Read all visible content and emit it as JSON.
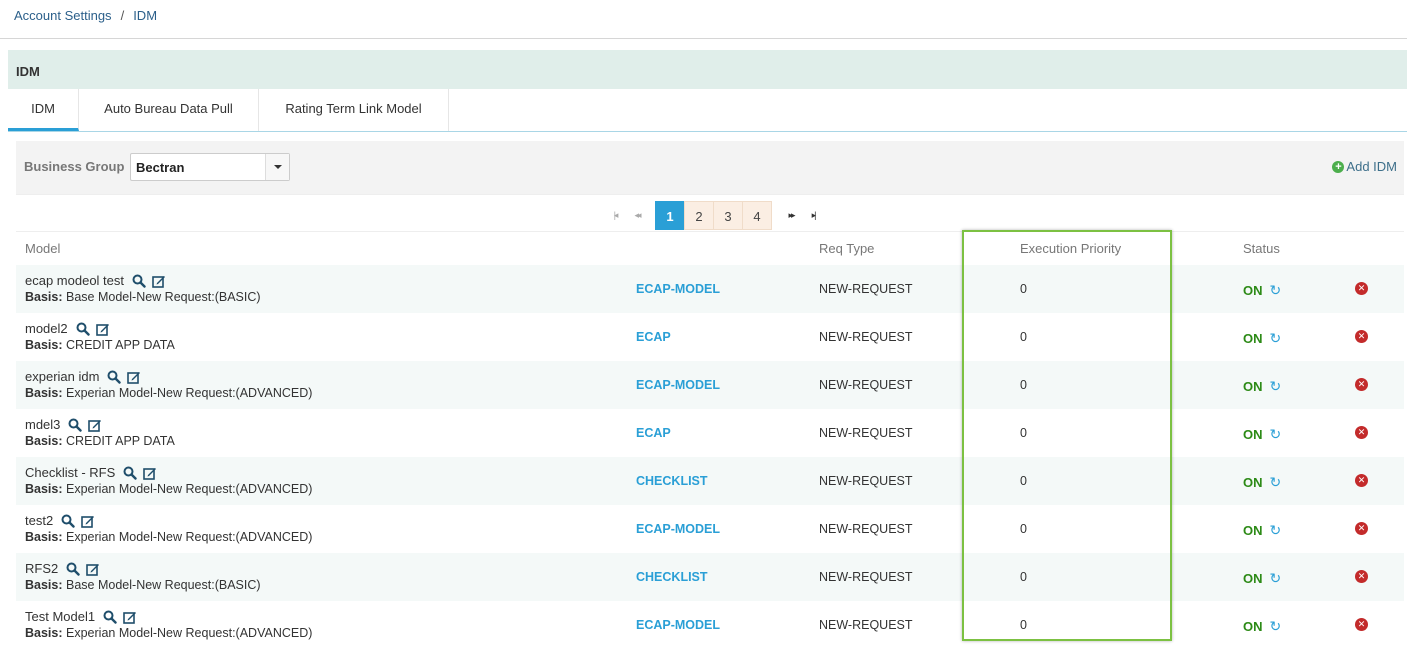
{
  "breadcrumb": {
    "parent": "Account Settings",
    "separator": "/",
    "current": "IDM"
  },
  "panel": {
    "title": "IDM"
  },
  "tabs": [
    {
      "label": "IDM",
      "active": true
    },
    {
      "label": "Auto Bureau Data Pull",
      "active": false
    },
    {
      "label": "Rating Term Link Model",
      "active": false
    }
  ],
  "filter": {
    "label": "Business Group",
    "selected": "Bectran"
  },
  "add_button": {
    "label": "Add IDM",
    "icon": "plus-circle-icon"
  },
  "pagination": {
    "pages": [
      "1",
      "2",
      "3",
      "4"
    ],
    "current": "1",
    "first": "|◂",
    "prev": "◂◂",
    "next": "▸▸",
    "last": "▸|"
  },
  "columns": {
    "model": "Model",
    "req_type": "Req Type",
    "priority": "Execution Priority",
    "status": "Status"
  },
  "basis_label": "Basis:",
  "rows": [
    {
      "name": "ecap modeol test",
      "basis": "Base Model-New Request:(BASIC)",
      "type": "ECAP-MODEL",
      "req": "NEW-REQUEST",
      "priority": "0",
      "status": "ON"
    },
    {
      "name": "model2",
      "basis": "CREDIT APP DATA",
      "type": "ECAP",
      "req": "NEW-REQUEST",
      "priority": "0",
      "status": "ON"
    },
    {
      "name": "experian idm",
      "basis": "Experian Model-New Request:(ADVANCED)",
      "type": "ECAP-MODEL",
      "req": "NEW-REQUEST",
      "priority": "0",
      "status": "ON"
    },
    {
      "name": "mdel3",
      "basis": "CREDIT APP DATA",
      "type": "ECAP",
      "req": "NEW-REQUEST",
      "priority": "0",
      "status": "ON"
    },
    {
      "name": "Checklist - RFS",
      "basis": "Experian Model-New Request:(ADVANCED)",
      "type": "CHECKLIST",
      "req": "NEW-REQUEST",
      "priority": "0",
      "status": "ON"
    },
    {
      "name": "test2",
      "basis": "Experian Model-New Request:(ADVANCED)",
      "type": "ECAP-MODEL",
      "req": "NEW-REQUEST",
      "priority": "0",
      "status": "ON"
    },
    {
      "name": "RFS2",
      "basis": "Base Model-New Request:(BASIC)",
      "type": "CHECKLIST",
      "req": "NEW-REQUEST",
      "priority": "0",
      "status": "ON"
    },
    {
      "name": "Test Model1",
      "basis": "Experian Model-New Request:(ADVANCED)",
      "type": "ECAP-MODEL",
      "req": "NEW-REQUEST",
      "priority": "0",
      "status": "ON"
    }
  ],
  "colors": {
    "accent": "#2a9fd6",
    "status_on": "#2c8a16",
    "delete": "#c32b2b",
    "highlight": "#7cc142",
    "header_bg": "#e0eeea"
  }
}
